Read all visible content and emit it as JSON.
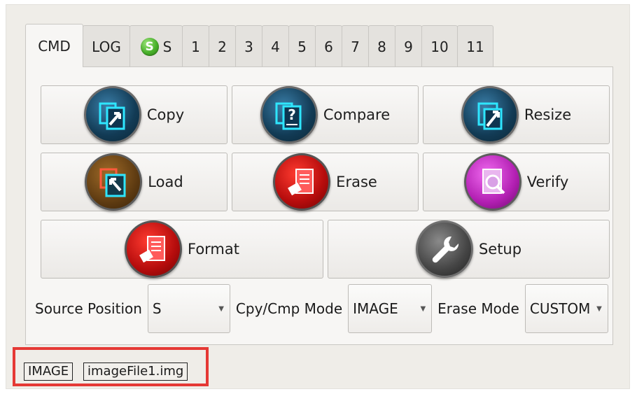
{
  "tabs": [
    {
      "label": "CMD",
      "active": true
    },
    {
      "label": "LOG"
    },
    {
      "label": "S",
      "icon": "green-s-icon",
      "icon_text": "S"
    },
    {
      "label": "1"
    },
    {
      "label": "2"
    },
    {
      "label": "3"
    },
    {
      "label": "4"
    },
    {
      "label": "5"
    },
    {
      "label": "6"
    },
    {
      "label": "7"
    },
    {
      "label": "8"
    },
    {
      "label": "9"
    },
    {
      "label": "10"
    },
    {
      "label": "11"
    }
  ],
  "buttons": {
    "copy": {
      "label": "Copy",
      "icon": "copy-icon"
    },
    "compare": {
      "label": "Compare",
      "icon": "compare-icon"
    },
    "resize": {
      "label": "Resize",
      "icon": "resize-icon"
    },
    "load": {
      "label": "Load",
      "icon": "load-icon"
    },
    "erase": {
      "label": "Erase",
      "icon": "erase-icon"
    },
    "verify": {
      "label": "Verify",
      "icon": "verify-icon"
    },
    "format": {
      "label": "Format",
      "icon": "format-icon"
    },
    "setup": {
      "label": "Setup",
      "icon": "wrench-icon"
    }
  },
  "options": {
    "source_position_label": "Source Position",
    "source_position_value": "S",
    "cpy_cmp_mode_label": "Cpy/Cmp Mode",
    "cpy_cmp_mode_value": "IMAGE",
    "erase_mode_label": "Erase Mode",
    "erase_mode_value": "CUSTOM"
  },
  "statusbar": {
    "mode": "IMAGE",
    "file": "imageFile1.img"
  },
  "colors": {
    "highlight": "#e53935",
    "s_icon": "#48b12a"
  }
}
